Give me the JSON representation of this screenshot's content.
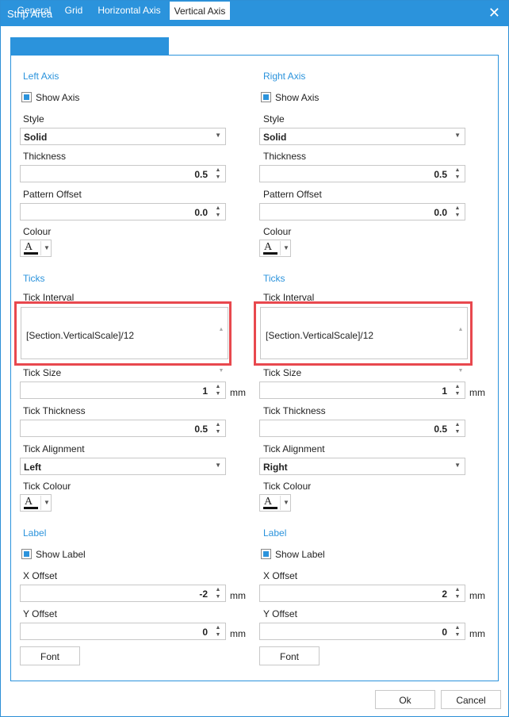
{
  "window": {
    "title": "Strip Area",
    "close_glyph": "✕"
  },
  "tabs": [
    {
      "label": "General"
    },
    {
      "label": "Grid"
    },
    {
      "label": "Horizontal Axis"
    },
    {
      "label": "Vertical Axis"
    }
  ],
  "active_tab": "Vertical Axis",
  "left": {
    "axis_heading": "Left Axis",
    "show_axis": {
      "label": "Show Axis",
      "checked": true
    },
    "style_label": "Style",
    "style_value": "Solid",
    "thickness_label": "Thickness",
    "thickness_value": "0.5",
    "pattern_label": "Pattern Offset",
    "pattern_value": "0.0",
    "colour_label": "Colour",
    "ticks_heading": "Ticks",
    "tick_interval_label": "Tick Interval",
    "tick_interval_value": "[Section.VerticalScale]/12",
    "tick_size_label": "Tick Size",
    "tick_size_value": "1",
    "tick_size_unit": "mm",
    "tick_thickness_label": "Tick Thickness",
    "tick_thickness_value": "0.5",
    "tick_alignment_label": "Tick Alignment",
    "tick_alignment_value": "Left",
    "tick_colour_label": "Tick Colour",
    "label_heading": "Label",
    "show_label": {
      "label": "Show Label",
      "checked": true
    },
    "x_offset_label": "X Offset",
    "x_offset_value": "-2",
    "x_offset_unit": "mm",
    "y_offset_label": "Y Offset",
    "y_offset_value": "0",
    "y_offset_unit": "mm",
    "font_button": "Font"
  },
  "right": {
    "axis_heading": "Right Axis",
    "show_axis": {
      "label": "Show Axis",
      "checked": true
    },
    "style_label": "Style",
    "style_value": "Solid",
    "thickness_label": "Thickness",
    "thickness_value": "0.5",
    "pattern_label": "Pattern Offset",
    "pattern_value": "0.0",
    "colour_label": "Colour",
    "ticks_heading": "Ticks",
    "tick_interval_label": "Tick Interval",
    "tick_interval_value": "[Section.VerticalScale]/12",
    "tick_size_label": "Tick Size",
    "tick_size_value": "1",
    "tick_size_unit": "mm",
    "tick_thickness_label": "Tick Thickness",
    "tick_thickness_value": "0.5",
    "tick_alignment_label": "Tick Alignment",
    "tick_alignment_value": "Right",
    "tick_colour_label": "Tick Colour",
    "label_heading": "Label",
    "show_label": {
      "label": "Show Label",
      "checked": true
    },
    "x_offset_label": "X Offset",
    "x_offset_value": "2",
    "x_offset_unit": "mm",
    "y_offset_label": "Y Offset",
    "y_offset_value": "0",
    "y_offset_unit": "mm",
    "font_button": "Font"
  },
  "footer": {
    "ok_label": "Ok",
    "cancel_label": "Cancel"
  },
  "glyphs": {
    "colour_letter": "A",
    "down_arrow": "▼",
    "spin_up": "▲",
    "spin_down": "▼"
  },
  "colors": {
    "accent": "#2b93dc",
    "highlight": "#e8484e"
  }
}
